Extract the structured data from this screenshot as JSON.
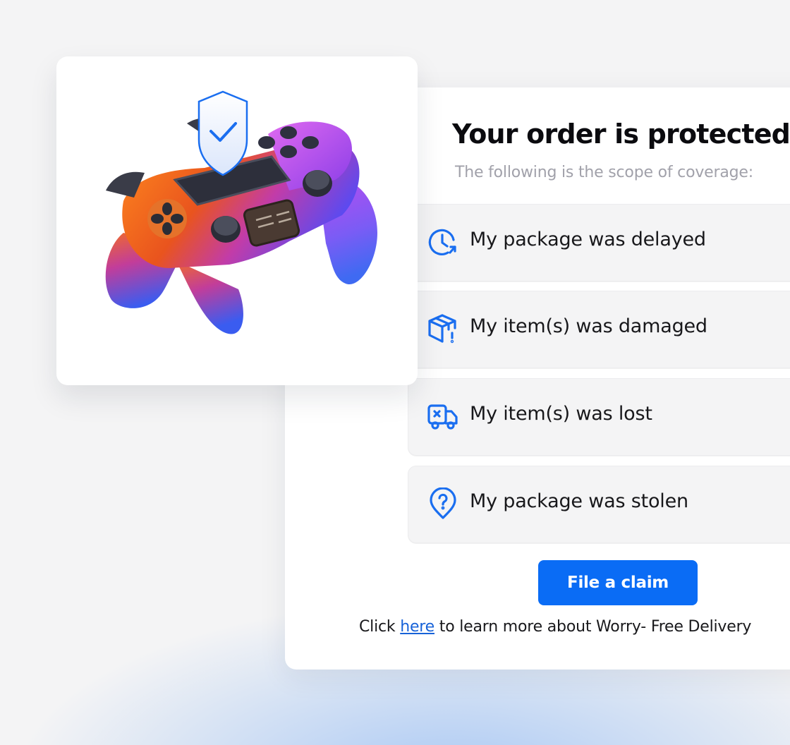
{
  "header": {
    "title": "Your order is protected",
    "subtitle": "The following is the scope of coverage:"
  },
  "coverage": {
    "items": [
      {
        "label": "My package was delayed",
        "icon": "clock-icon"
      },
      {
        "label": "My item(s) was damaged",
        "icon": "damaged-box-icon"
      },
      {
        "label": "My item(s) was lost",
        "icon": "truck-x-icon"
      },
      {
        "label": "My package was stolen",
        "icon": "location-question-icon"
      }
    ]
  },
  "actions": {
    "claim_label": "File a claim"
  },
  "footer": {
    "prefix": "Click ",
    "link_text": "here",
    "suffix": " to learn more about Worry- Free Delivery"
  },
  "product": {
    "image": "game-controller-with-shield-checkmark"
  },
  "colors": {
    "accent": "#0a6cf5",
    "icon": "#1a6ef0",
    "link": "#1762d8",
    "title": "#0b0b0f",
    "subtitle": "#a1a1aa",
    "item_bg": "#f4f4f5"
  }
}
